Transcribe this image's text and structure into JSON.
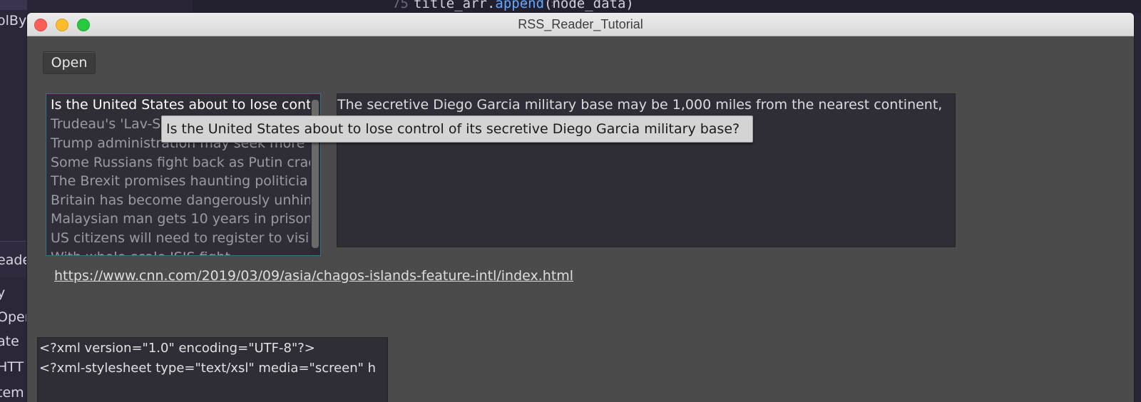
{
  "background": {
    "left_items": [
      "olBy",
      "eade",
      "y",
      "Open",
      "ate",
      "HTT",
      "tem"
    ],
    "line_number": "75",
    "code_prefix": "title_arr.",
    "code_fn": "append",
    "code_suffix": "(node_data)"
  },
  "window": {
    "title": "RSS_Reader_Tutorial"
  },
  "toolbar": {
    "open_label": "Open"
  },
  "feed_list": {
    "items": [
      "Is the United States about to lose control of its secretive  Diego Garcia military base?",
      "Trudeau's 'Lav-Scam'",
      "Trump administration may seek more",
      "Some Russians fight back as Putin crac",
      "The Brexit promises haunting politicia",
      "Britain has become dangerously unhin",
      "Malaysian man gets 10 years in prison",
      "US citizens will need to register to visi",
      "With whole-scale ISIS fight"
    ],
    "selected_index": 0
  },
  "tooltip": {
    "text": "Is the United States about to lose control of its secretive  Diego Garcia military base?"
  },
  "description": {
    "text": "The secretive Diego Garcia military base may be 1,000 miles from the nearest continent,"
  },
  "article": {
    "url": "https://www.cnn.com/2019/03/09/asia/chagos-islands-feature-intl/index.html"
  },
  "xml_source": {
    "lines": [
      "<?xml version=\"1.0\" encoding=\"UTF-8\"?>",
      "<?xml-stylesheet type=\"text/xsl\" media=\"screen\" h"
    ]
  },
  "colors": {
    "window_bg": "#4b4b4b",
    "panel_bg": "#2f2e36",
    "list_border": "#3a6f8a",
    "tooltip_bg": "#d4d4d4"
  }
}
